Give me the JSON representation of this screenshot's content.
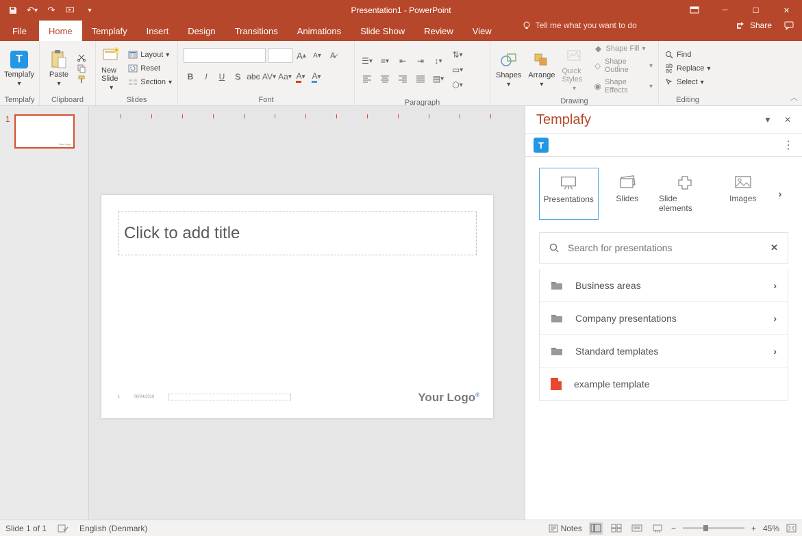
{
  "titlebar": {
    "title": "Presentation1 - PowerPoint"
  },
  "tabs": {
    "file": "File",
    "home": "Home",
    "templafy": "Templafy",
    "insert": "Insert",
    "design": "Design",
    "transitions": "Transitions",
    "animations": "Animations",
    "slideshow": "Slide Show",
    "review": "Review",
    "view": "View",
    "tellme": "Tell me what you want to do",
    "share": "Share"
  },
  "ribbon": {
    "templafy_btn": "Templafy",
    "paste": "Paste",
    "new_slide": "New Slide",
    "layout": "Layout",
    "reset": "Reset",
    "section": "Section",
    "shapes": "Shapes",
    "arrange": "Arrange",
    "quick_styles": "Quick Styles",
    "shape_fill": "Shape Fill",
    "shape_outline": "Shape Outline",
    "shape_effects": "Shape Effects",
    "find": "Find",
    "replace": "Replace",
    "select": "Select",
    "group_templafy": "Templafy",
    "group_clipboard": "Clipboard",
    "group_slides": "Slides",
    "group_font": "Font",
    "group_paragraph": "Paragraph",
    "group_drawing": "Drawing",
    "group_editing": "Editing"
  },
  "slide": {
    "number": "1",
    "title_placeholder": "Click to add title",
    "date_small": "06/04/2018",
    "logo": "Your Logo"
  },
  "pane": {
    "title": "Templafy",
    "cat_presentations": "Presentations",
    "cat_slides": "Slides",
    "cat_slide_elements": "Slide elements",
    "cat_images": "Images",
    "search_placeholder": "Search for presentations",
    "folders": [
      {
        "label": "Business areas",
        "type": "folder"
      },
      {
        "label": "Company presentations",
        "type": "folder"
      },
      {
        "label": "Standard templates",
        "type": "folder"
      },
      {
        "label": "example template",
        "type": "file"
      }
    ]
  },
  "status": {
    "slide_of": "Slide 1 of 1",
    "language": "English (Denmark)",
    "notes": "Notes",
    "zoom": "45%"
  }
}
